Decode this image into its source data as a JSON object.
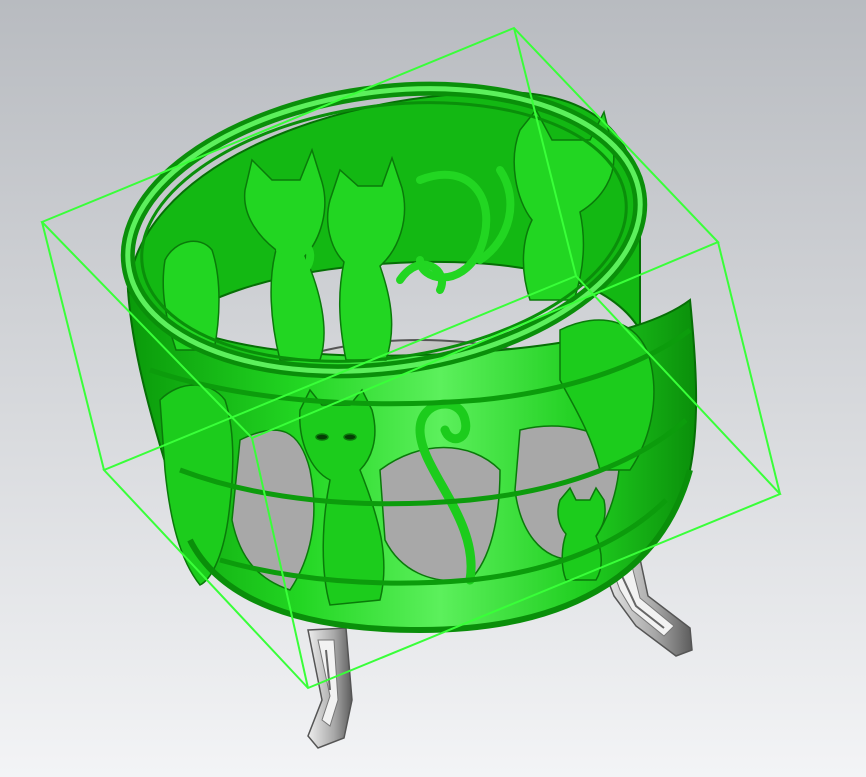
{
  "scene": {
    "subject": "fire-pit-with-cat-cutouts",
    "colors": {
      "background_top": "#b9bcc0",
      "background_bottom": "#f2f3f5",
      "body_green": "#1fd11f",
      "body_green_dark": "#0a8f0a",
      "body_green_light": "#6af26a",
      "bounding_box": "#39ff39",
      "inner_gray": "#b8b8b8",
      "inner_gray_dark": "#7c7c7c",
      "leg_gray": "#cfcfcf",
      "leg_gray_dark": "#5c5c5c"
    }
  }
}
